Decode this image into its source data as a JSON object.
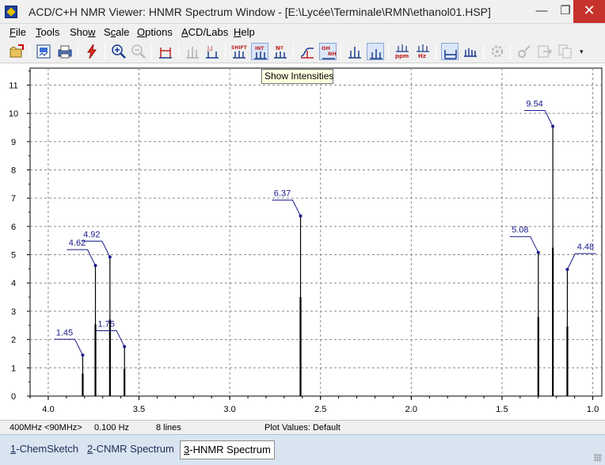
{
  "window": {
    "title": "ACD/C+H NMR Viewer: HNMR Spectrum Window - [E:\\Lycée\\Terminale\\RMN\\ethanol01.HSP]",
    "minimize_glyph": "—",
    "restore_glyph": "❐",
    "close_glyph": "✕"
  },
  "menu": {
    "items": [
      {
        "key": "F",
        "rest": "ile"
      },
      {
        "key": "T",
        "rest": "ools"
      },
      {
        "pre": "Sho",
        "key": "w",
        "rest": ""
      },
      {
        "pre": "S",
        "key": "c",
        "rest": "ale"
      },
      {
        "key": "O",
        "rest": "ptions"
      },
      {
        "key": "A",
        "rest": "CD/Labs"
      },
      {
        "key": "H",
        "rest": "elp"
      }
    ]
  },
  "toolbar": {
    "buttons": [
      {
        "name": "open-icon"
      },
      {
        "name": "save-image-icon"
      },
      {
        "name": "print-icon"
      },
      {
        "name": "lightning-icon"
      },
      {
        "name": "zoom-in-icon"
      },
      {
        "name": "zoom-out-icon"
      },
      {
        "name": "peak-width-icon"
      },
      {
        "name": "multiplet-disabled-icon"
      },
      {
        "name": "coupling-constant-icon"
      },
      {
        "name": "shift-icon"
      },
      {
        "name": "show-intensities-icon"
      },
      {
        "name": "proton-count-icon"
      },
      {
        "name": "integral-curve-icon"
      },
      {
        "name": "oh-nh-icon"
      },
      {
        "name": "peak-labels-icon"
      },
      {
        "name": "peaks-overlay-icon"
      },
      {
        "name": "ppm-scale-icon"
      },
      {
        "name": "hz-scale-icon"
      },
      {
        "name": "baseline-icon"
      },
      {
        "name": "spectrum-icon"
      },
      {
        "name": "settings-disabled-icon"
      },
      {
        "name": "tools-disabled-icon"
      },
      {
        "name": "export-disabled-icon"
      },
      {
        "name": "copy-disabled-icon"
      }
    ],
    "labels": {
      "shift": "SHIFT",
      "int": "INT",
      "n": "Nº",
      "oh": "OH",
      "nh": "NH",
      "ppm": "ppm",
      "hz": "Hz",
      "jj": "J,J"
    },
    "overflow_glyph": "▾",
    "tooltip": "Show Intensities"
  },
  "status": {
    "frequency": "400MHz <90MHz>",
    "resolution": "0.100 Hz",
    "lines": "8 lines",
    "plot_values": "Plot Values: Default"
  },
  "tabs": [
    {
      "num": "1",
      "label": "-ChemSketch"
    },
    {
      "num": "2",
      "label": "-CNMR Spectrum"
    },
    {
      "num": "3",
      "label": "-HNMR Spectrum"
    }
  ],
  "chart_data": {
    "type": "bar",
    "xlabel": "",
    "ylabel": "",
    "xlim": [
      4.1,
      0.95
    ],
    "ylim": [
      0,
      11.6
    ],
    "x_ticks": [
      "4.0",
      "3.5",
      "3.0",
      "2.5",
      "2.0",
      "1.5",
      "1.0"
    ],
    "y_ticks": [
      "0",
      "1",
      "2",
      "3",
      "4",
      "5",
      "6",
      "7",
      "8",
      "9",
      "10",
      "11"
    ],
    "grid": true,
    "peaks": [
      {
        "x": 3.81,
        "intensity": 1.45,
        "label": "1.45"
      },
      {
        "x": 3.74,
        "intensity": 4.62,
        "label": "4.62"
      },
      {
        "x": 3.66,
        "intensity": 4.92,
        "label": "4.92"
      },
      {
        "x": 3.58,
        "intensity": 1.75,
        "label": "1.75"
      },
      {
        "x": 2.61,
        "intensity": 6.37,
        "label": "6.37"
      },
      {
        "x": 1.3,
        "intensity": 5.08,
        "label": "5.08"
      },
      {
        "x": 1.22,
        "intensity": 9.54,
        "label": "9.54"
      },
      {
        "x": 1.14,
        "intensity": 4.48,
        "label": "4.48"
      }
    ],
    "colors": {
      "peak": "#000000",
      "label": "#1a1a8c",
      "grid": "#8a8a8a",
      "axis": "#000000"
    }
  }
}
